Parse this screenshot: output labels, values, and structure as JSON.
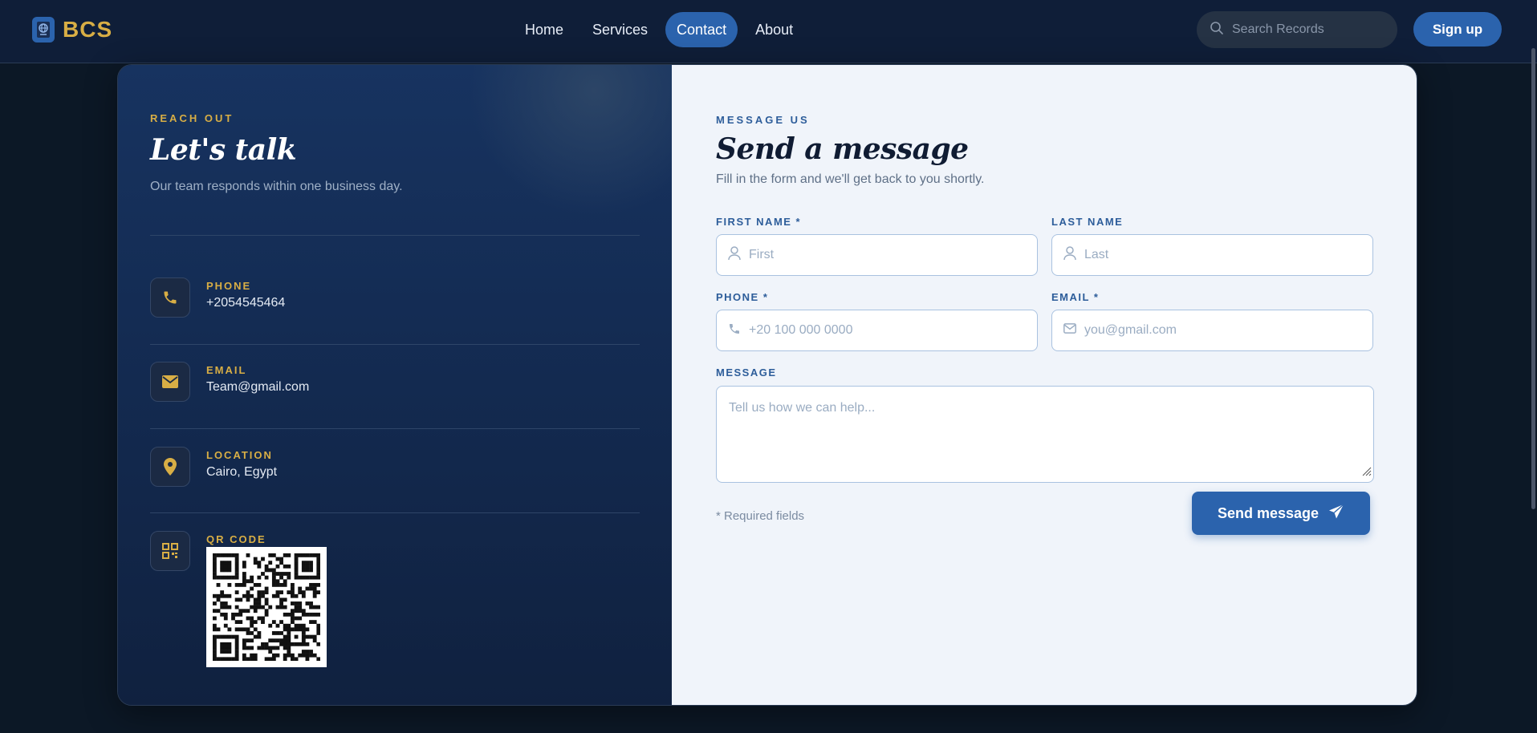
{
  "header": {
    "brand": "BCS",
    "nav": [
      {
        "label": "Home",
        "active": false
      },
      {
        "label": "Services",
        "active": false
      },
      {
        "label": "Contact",
        "active": true
      },
      {
        "label": "About",
        "active": false
      }
    ],
    "search_placeholder": "Search Records",
    "signup_label": "Sign up"
  },
  "contact_info": {
    "eyebrow": "REACH OUT",
    "title": "Let's talk",
    "subtitle": "Our team responds within one business day.",
    "items": [
      {
        "label": "PHONE",
        "value": "+2054545464",
        "icon": "phone-icon"
      },
      {
        "label": "EMAIL",
        "value": "Team@gmail.com",
        "icon": "envelope-icon"
      },
      {
        "label": "LOCATION",
        "value": "Cairo, Egypt",
        "icon": "map-pin-icon"
      },
      {
        "label": "QR CODE",
        "icon": "qr-code-icon"
      }
    ]
  },
  "form": {
    "eyebrow": "MESSAGE US",
    "title": "Send a message",
    "subtitle": "Fill in the form and we'll get back to you shortly.",
    "first_name": {
      "label": "FIRST NAME *",
      "placeholder": "First",
      "value": ""
    },
    "last_name": {
      "label": "LAST NAME",
      "placeholder": "Last",
      "value": ""
    },
    "phone": {
      "label": "PHONE *",
      "placeholder": "+20 100 000 0000",
      "value": ""
    },
    "email": {
      "label": "EMAIL *",
      "placeholder": "you@gmail.com",
      "value": ""
    },
    "message": {
      "label": "MESSAGE",
      "placeholder": "Tell us how we can help...",
      "value": ""
    },
    "required_note": "* Required fields",
    "submit_label": "Send message"
  },
  "colors": {
    "accent": "#2b63ad",
    "gold": "#d8ae45",
    "navy": "#0f1e38"
  }
}
